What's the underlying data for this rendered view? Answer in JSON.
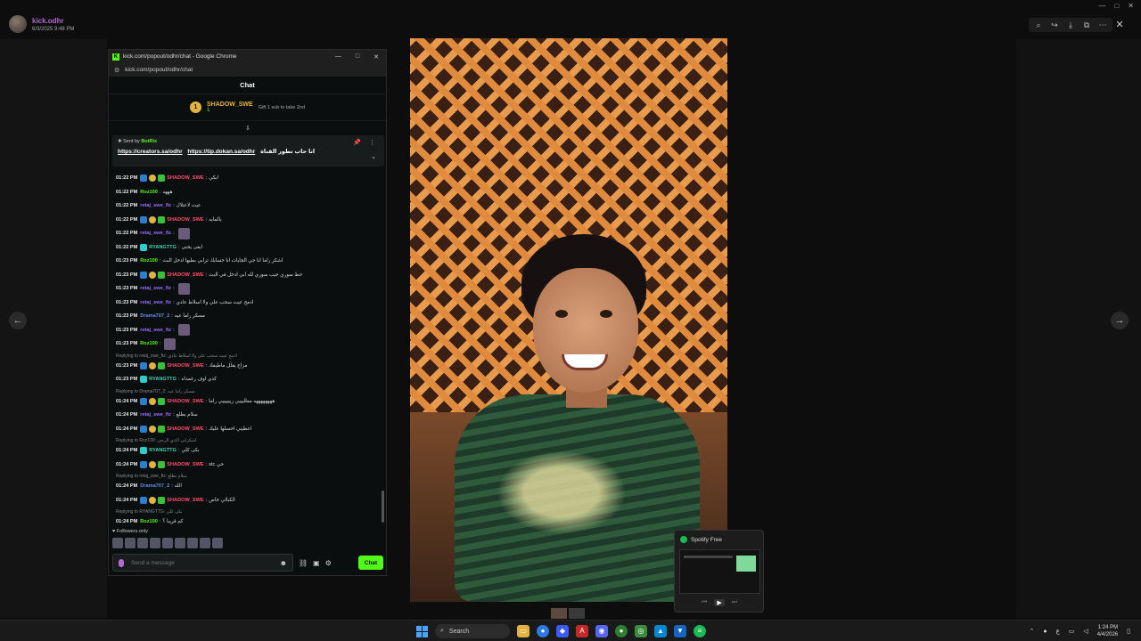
{
  "viewer": {
    "username": "kick.odhr",
    "datetime": "6/3/2025 9:48 PM",
    "tools": [
      "zoom-icon",
      "share-icon",
      "download-icon",
      "open-icon",
      "more-icon"
    ]
  },
  "popout": {
    "window_title": "kick.com/popout/odhr/chat - Google Chrome",
    "url": "kick.com/popout/odhr/chat",
    "chat_header": "Chat",
    "gifter": {
      "rank": "1",
      "name": "SHADOW_SWE",
      "count": "1",
      "hint": "Gift 1 sub to take 2nd"
    },
    "pinned": {
      "sent_by_label": "Sent by",
      "bot_name": "BotRix",
      "link1": "https://creators.sa/odhr",
      "link2": "https://tip.dokan.sa/odhr",
      "text": "انا حاب تطور القناة"
    },
    "messages": [
      {
        "time": "01:22 PM",
        "user": "SHADOW_SWE",
        "color": "red",
        "badges": [
          "blue",
          "gold",
          "green"
        ],
        "text": "ابكي"
      },
      {
        "time": "01:22 PM",
        "user": "Roz100",
        "color": "green",
        "badges": [],
        "text": "هههه"
      },
      {
        "time": "01:22 PM",
        "user": "retaj_swe_fiz",
        "color": "purple",
        "badges": [],
        "text": "عيث لاعتلال"
      },
      {
        "time": "01:22 PM",
        "user": "SHADOW_SWE",
        "color": "red",
        "badges": [
          "blue",
          "gold",
          "green"
        ],
        "text": "بالمايه"
      },
      {
        "time": "01:22 PM",
        "user": "retaj_swe_fiz",
        "color": "purple",
        "badges": [],
        "text": "",
        "emote": true
      },
      {
        "time": "01:22 PM",
        "user": "RYANGTTG",
        "color": "teal",
        "badges": [
          "cyan"
        ],
        "text": "ابغى يحنى"
      },
      {
        "time": "01:23 PM",
        "user": "Roz100",
        "color": "green",
        "badges": [],
        "text": "اشكر راما انا جي الجايات انا حسابك ترابي بطيها ادخل البث"
      },
      {
        "time": "01:23 PM",
        "user": "SHADOW_SWE",
        "color": "red",
        "badges": [
          "blue",
          "gold",
          "green"
        ],
        "text": "حط سوري جيب سوري لله ابي ادخل في البث"
      },
      {
        "time": "01:23 PM",
        "user": "retaj_swe_fiz",
        "color": "purple",
        "badges": [],
        "text": "",
        "emote": true
      },
      {
        "time": "01:23 PM",
        "user": "retaj_swe_fiz",
        "color": "purple",
        "badges": [],
        "text": "ادمح عيث سحب علي ولا اسلاط عادي"
      },
      {
        "time": "01:23 PM",
        "user": "Drama707_2",
        "color": "blue",
        "badges": [],
        "text": "مسكر راما عيه"
      },
      {
        "time": "01:23 PM",
        "user": "retaj_swe_fiz",
        "color": "purple",
        "badges": [],
        "text": "",
        "emote": true
      },
      {
        "time": "01:23 PM",
        "user": "Roz100",
        "color": "green",
        "badges": [],
        "text": "",
        "emote": true
      },
      {
        "reply": "Replying to retaj_swe_fiz: ادمح عيث سحب علي ولا اسلاط عادي"
      },
      {
        "time": "01:23 PM",
        "user": "SHADOW_SWE",
        "color": "red",
        "badges": [
          "blue",
          "gold",
          "green"
        ],
        "text": "مزاح يقلل ماطيفك"
      },
      {
        "time": "01:23 PM",
        "user": "RYANGTTG",
        "color": "teal",
        "badges": [
          "cyan"
        ],
        "text": "كذي اوف رغمداه"
      },
      {
        "reply": "Replying to Drama707_2: مسكر راما عيه"
      },
      {
        "time": "01:24 PM",
        "user": "SHADOW_SWE",
        "color": "red",
        "badges": [
          "blue",
          "gold",
          "green"
        ],
        "text": "ههههههههه معلليييي زييييييي راما"
      },
      {
        "time": "01:24 PM",
        "user": "retaj_swe_fiz",
        "color": "purple",
        "badges": [],
        "text": "سلام بطلع"
      },
      {
        "time": "01:24 PM",
        "user": "SHADOW_SWE",
        "color": "red",
        "badges": [
          "blue",
          "gold",
          "green"
        ],
        "text": "اعطيني احسلها عليك"
      },
      {
        "reply": "Replying to Roz100: اشكراني اكذي الرحي"
      },
      {
        "time": "01:24 PM",
        "user": "RYANGTTG",
        "color": "teal",
        "badges": [
          "cyan"
        ],
        "text": "بكى كلي"
      },
      {
        "time": "01:24 PM",
        "user": "SHADOW_SWE",
        "color": "red",
        "badges": [
          "blue",
          "gold",
          "green"
        ],
        "text": "stc حي"
      },
      {
        "reply": "Replying to retaj_swe_fiz: سلام بطلع"
      },
      {
        "time": "01:24 PM",
        "user": "Drama707_2",
        "color": "blue",
        "badges": [],
        "text": "الله"
      },
      {
        "time": "01:24 PM",
        "user": "SHADOW_SWE",
        "color": "red",
        "badges": [
          "blue",
          "gold",
          "green"
        ],
        "text": "الكبالي خاص"
      },
      {
        "reply": "Replying to RYANGTTG: بكى كلي"
      },
      {
        "time": "01:24 PM",
        "user": "Roz100",
        "color": "green",
        "badges": [],
        "text": "كم قريبا ؟"
      }
    ],
    "followers_only": "Followers only",
    "input_placeholder": "Send a message",
    "send_label": "Chat"
  },
  "spotify": {
    "title": "Spotify Free"
  },
  "taskbar": {
    "search_label": "Search",
    "time": "1:24 PM",
    "date": "4/4/2026"
  }
}
